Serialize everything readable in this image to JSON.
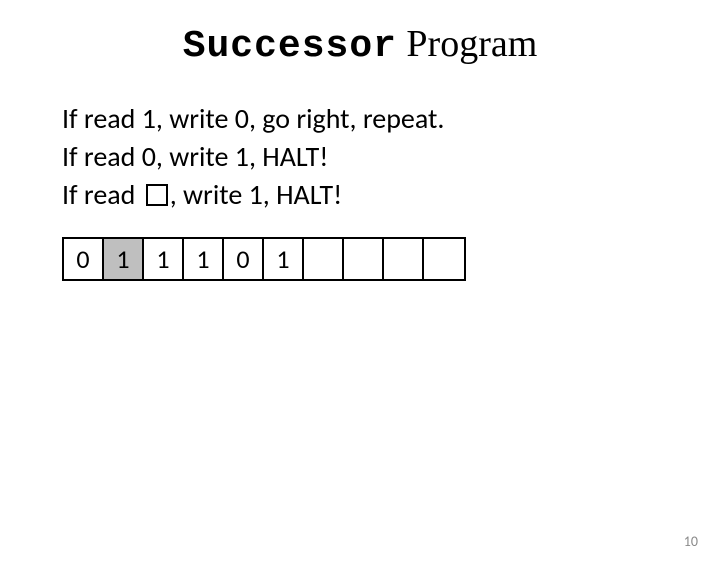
{
  "title": {
    "word1": "Successor",
    "word2": " Program"
  },
  "rules": {
    "line1": "If read 1, write 0, go right, repeat.",
    "line2": "If read 0, write 1, HALT!",
    "line3_a": "If read ",
    "line3_b": ", write 1, HALT!"
  },
  "tape": {
    "cells": [
      "0",
      "1",
      "1",
      "1",
      "0",
      "1",
      "",
      "",
      "",
      ""
    ],
    "head_index": 1
  },
  "page_number": "10"
}
